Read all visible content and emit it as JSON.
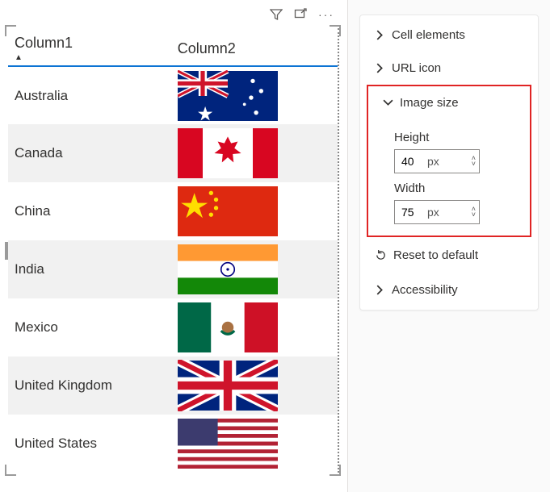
{
  "table": {
    "headers": {
      "col1": "Column1",
      "col2": "Column2"
    },
    "rows": [
      {
        "country": "Australia",
        "flag": "australia"
      },
      {
        "country": "Canada",
        "flag": "canada"
      },
      {
        "country": "China",
        "flag": "china"
      },
      {
        "country": "India",
        "flag": "india"
      },
      {
        "country": "Mexico",
        "flag": "mexico"
      },
      {
        "country": "United Kingdom",
        "flag": "uk"
      },
      {
        "country": "United States",
        "flag": "usa"
      }
    ]
  },
  "format_pane": {
    "sections": {
      "cell_elements": "Cell elements",
      "url_icon": "URL icon",
      "image_size": "Image size",
      "accessibility": "Accessibility"
    },
    "image_size": {
      "height_label": "Height",
      "height_value": "40",
      "height_unit": "px",
      "width_label": "Width",
      "width_value": "75",
      "width_unit": "px"
    },
    "reset_label": "Reset to default"
  }
}
